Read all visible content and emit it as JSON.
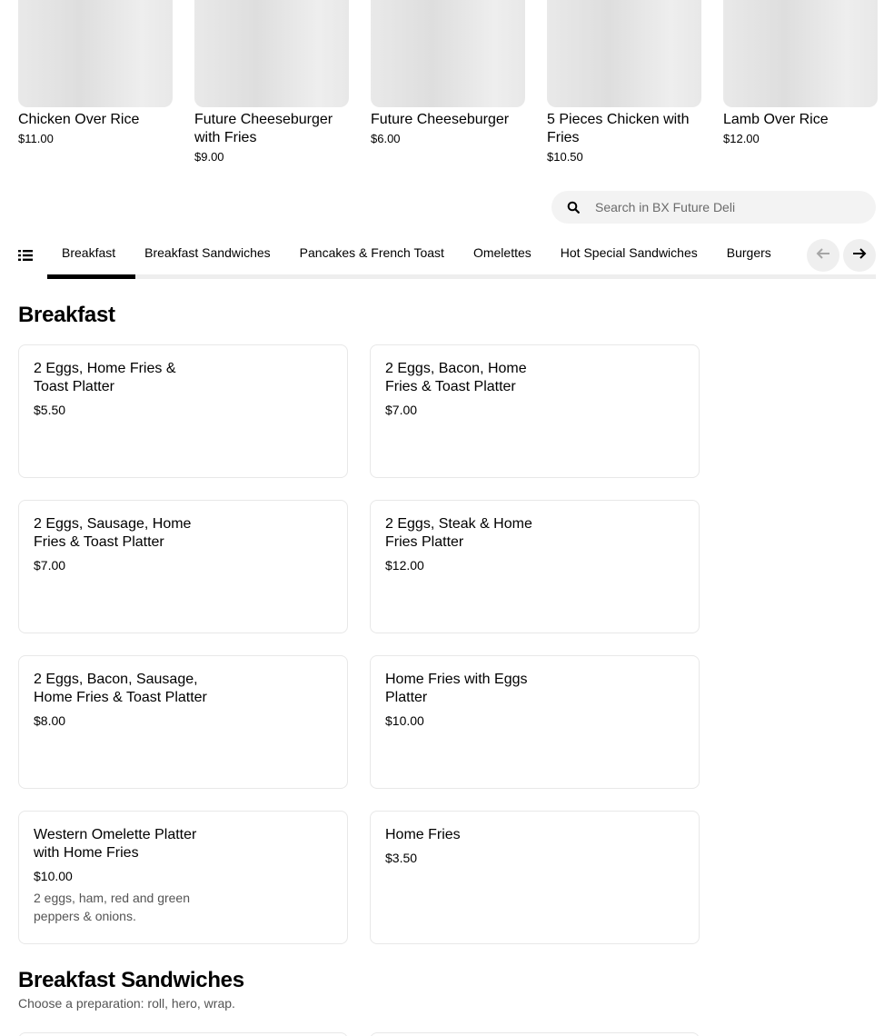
{
  "featured": [
    {
      "name": "Chicken Over Rice",
      "price": "$11.00"
    },
    {
      "name": "Future Cheeseburger with Fries",
      "price": "$9.00"
    },
    {
      "name": "Future Cheeseburger",
      "price": "$6.00"
    },
    {
      "name": "5 Pieces Chicken with Fries",
      "price": "$10.50"
    },
    {
      "name": "Lamb Over Rice",
      "price": "$12.00"
    }
  ],
  "search": {
    "placeholder": "Search in BX Future Deli",
    "value": ""
  },
  "tabs": [
    {
      "label": "Breakfast",
      "active": true
    },
    {
      "label": "Breakfast Sandwiches",
      "active": false
    },
    {
      "label": "Pancakes & French Toast",
      "active": false
    },
    {
      "label": "Omelettes",
      "active": false
    },
    {
      "label": "Hot Special Sandwiches",
      "active": false
    },
    {
      "label": "Burgers",
      "active": false
    }
  ],
  "icons": {
    "search": "search-icon",
    "menu_list": "list-icon",
    "prev": "arrow-left-icon",
    "next": "arrow-right-icon"
  },
  "sections": [
    {
      "title": "Breakfast",
      "subtitle": "",
      "items": [
        {
          "name": "2 Eggs, Home Fries & Toast Platter",
          "price": "$5.50",
          "description": ""
        },
        {
          "name": "2 Eggs, Bacon, Home Fries & Toast Platter",
          "price": "$7.00",
          "description": ""
        },
        {
          "name": "2 Eggs, Sausage, Home Fries & Toast Platter",
          "price": "$7.00",
          "description": ""
        },
        {
          "name": "2 Eggs, Steak & Home Fries Platter",
          "price": "$12.00",
          "description": ""
        },
        {
          "name": "2 Eggs, Bacon, Sausage, Home Fries & Toast Platter",
          "price": "$8.00",
          "description": ""
        },
        {
          "name": "Home Fries with Eggs Platter",
          "price": "$10.00",
          "description": ""
        },
        {
          "name": "Western Omelette Platter with Home Fries",
          "price": "$10.00",
          "description": "2 eggs, ham, red and green peppers & onions."
        },
        {
          "name": "Home Fries",
          "price": "$3.50",
          "description": ""
        }
      ]
    },
    {
      "title": "Breakfast Sandwiches",
      "subtitle": "Choose a preparation: roll, hero, wrap."
    }
  ]
}
